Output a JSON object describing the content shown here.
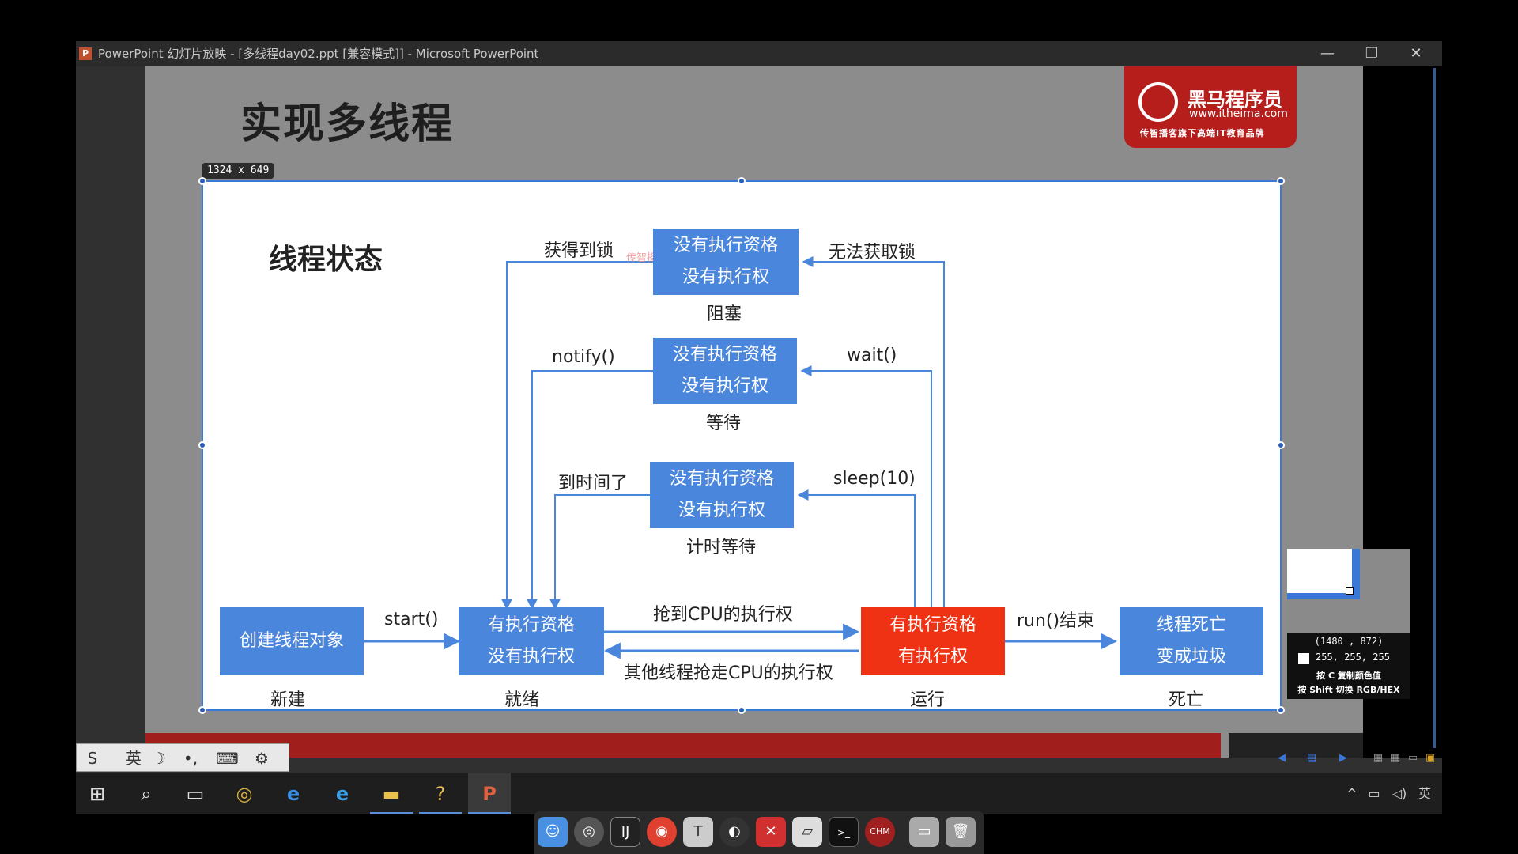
{
  "window": {
    "title": "PowerPoint 幻灯片放映 - [多线程day02.ppt [兼容模式]] - Microsoft PowerPoint",
    "app_icon": "P",
    "minimize_glyph": "—",
    "restore_glyph": "❐",
    "close_glyph": "✕"
  },
  "slide": {
    "title": "实现多线程",
    "logo": {
      "name": "黑马程序员",
      "url": "www.itheima.com",
      "slogan": "传智播客旗下高端IT教育品牌"
    }
  },
  "selection": {
    "size_label": "1324 x 649"
  },
  "diagram": {
    "title": "线程状态",
    "states": [
      {
        "id": "blocked",
        "line1": "没有执行资格",
        "line2": "没有执行权",
        "caption": "阻塞"
      },
      {
        "id": "waiting",
        "line1": "没有执行资格",
        "line2": "没有执行权",
        "caption": "等待"
      },
      {
        "id": "timed-waiting",
        "line1": "没有执行资格",
        "line2": "没有执行权",
        "caption": "计时等待"
      },
      {
        "id": "new",
        "line1": "创建线程对象",
        "line2": "",
        "caption": "新建"
      },
      {
        "id": "runnable",
        "line1": "有执行资格",
        "line2": "没有执行权",
        "caption": "就绪"
      },
      {
        "id": "running",
        "line1": "有执行资格",
        "line2": "有执行权",
        "caption": "运行"
      },
      {
        "id": "terminated",
        "line1": "线程死亡",
        "line2": "变成垃圾",
        "caption": "死亡"
      }
    ],
    "transitions": {
      "got_lock": "获得到锁",
      "cannot_get_lock": "无法获取锁",
      "notify": "notify()",
      "wait": "wait()",
      "time_up": "到时间了",
      "sleep": "sleep(10)",
      "start": "start()",
      "grab_cpu": "抢到CPU的执行权",
      "lose_cpu": "其他线程抢走CPU的执行权",
      "run_end": "run()结束"
    },
    "watermark": "传智播客"
  },
  "color_picker": {
    "coords": "(1480 , 872)",
    "rgb": "255, 255, 255",
    "tip_copy": "按 C 复制颜色值",
    "tip_switch": "按 Shift 切换 RGB/HEX"
  },
  "ime_bar": {
    "items": [
      "S",
      "英",
      "☽",
      "•,",
      "⌨",
      "⚙"
    ]
  },
  "taskbar": {
    "tray_ime": "英",
    "tray_chevron": "^",
    "tray_network": "▭",
    "tray_volume": "◁)"
  },
  "colors": {
    "state_blue": "#4a86db",
    "state_red": "#f03214",
    "arrow_blue": "#4a86db",
    "logo_red": "#b51e1b"
  }
}
